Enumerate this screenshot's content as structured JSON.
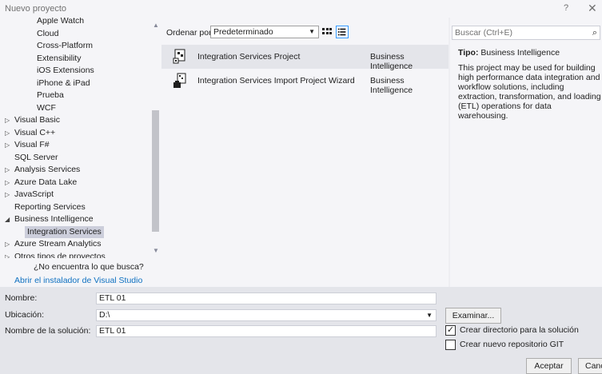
{
  "window": {
    "title": "Nuevo proyecto",
    "help": "?",
    "close": "✕"
  },
  "tree": {
    "items": [
      {
        "label": "Apple Watch",
        "arrow": "",
        "indent": 2
      },
      {
        "label": "Cloud",
        "arrow": "",
        "indent": 2
      },
      {
        "label": "Cross-Platform",
        "arrow": "",
        "indent": 2
      },
      {
        "label": "Extensibility",
        "arrow": "",
        "indent": 2
      },
      {
        "label": "iOS Extensions",
        "arrow": "",
        "indent": 2
      },
      {
        "label": "iPhone & iPad",
        "arrow": "",
        "indent": 2
      },
      {
        "label": "Prueba",
        "arrow": "",
        "indent": 2
      },
      {
        "label": "WCF",
        "arrow": "",
        "indent": 2
      },
      {
        "label": "Visual Basic",
        "arrow": "▷",
        "indent": 1
      },
      {
        "label": "Visual C++",
        "arrow": "▷",
        "indent": 1
      },
      {
        "label": "Visual F#",
        "arrow": "▷",
        "indent": 1
      },
      {
        "label": "SQL Server",
        "arrow": "",
        "indent": 1
      },
      {
        "label": "Analysis Services",
        "arrow": "▷",
        "indent": 1
      },
      {
        "label": "Azure Data Lake",
        "arrow": "▷",
        "indent": 1
      },
      {
        "label": "JavaScript",
        "arrow": "▷",
        "indent": 1
      },
      {
        "label": "Reporting Services",
        "arrow": "",
        "indent": 1
      },
      {
        "label": "Business Intelligence",
        "arrow": "◢",
        "indent": 1
      },
      {
        "label": "Integration Services",
        "arrow": "",
        "indent": 2,
        "selected": true
      },
      {
        "label": "Azure Stream Analytics",
        "arrow": "▷",
        "indent": 1
      },
      {
        "label": "Otros tipos de proyectos",
        "arrow": "▷",
        "indent": 1
      }
    ],
    "not_found_question": "¿No encuentra lo que busca?",
    "installer_link": "Abrir el instalador de Visual Studio"
  },
  "sort": {
    "label": "Ordenar por:",
    "value": "Predeterminado"
  },
  "projects": [
    {
      "name": "Integration Services Project",
      "type": "Business Intelligence",
      "selected": true
    },
    {
      "name": "Integration Services Import Project Wizard",
      "type": "Business Intelligence",
      "selected": false
    }
  ],
  "details": {
    "search_placeholder": "Buscar (Ctrl+E)",
    "type_label": "Tipo:",
    "type_value": "Business Intelligence",
    "description": "This project may be used for building high performance data integration and workflow solutions, including extraction, transformation, and loading (ETL) operations for data warehousing."
  },
  "form": {
    "name_label": "Nombre:",
    "name_value": "ETL 01",
    "location_label": "Ubicación:",
    "location_value": "D:\\",
    "solution_label": "Nombre de la solución:",
    "solution_value": "ETL 01",
    "browse_label": "Examinar...",
    "create_dir_label": "Crear directorio para la solución",
    "create_dir_checked": true,
    "git_label": "Crear nuevo repositorio GIT",
    "git_checked": false,
    "accept_label": "Aceptar",
    "cancel_label": "Cancelar"
  }
}
